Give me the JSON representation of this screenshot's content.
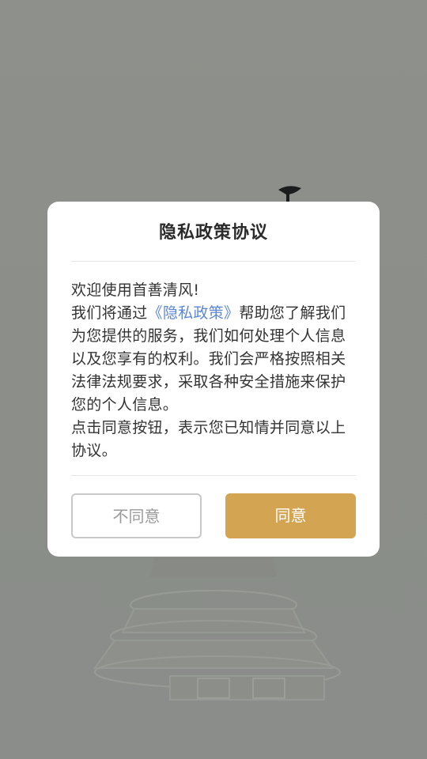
{
  "dialog": {
    "title": "隐私政策协议",
    "greeting": "欢迎使用首善清风!",
    "intro_before_link": "我们将通过",
    "policy_link": "《隐私政策》",
    "intro_after_link": "帮助您了解我们为您提供的服务，我们如何处理个人信息以及您享有的权利。我们会严格按照相关法律法规要求，采取各种安全措施来保护您的个人信息。",
    "consent_note": "点击同意按钮，表示您已知情并同意以上协议。",
    "disagree_label": "不同意",
    "agree_label": "同意"
  },
  "colors": {
    "overlay": "#8b8e89",
    "link": "#5b86d6",
    "agree_button": "#d3a552",
    "disagree_border": "#c8c8c8"
  }
}
